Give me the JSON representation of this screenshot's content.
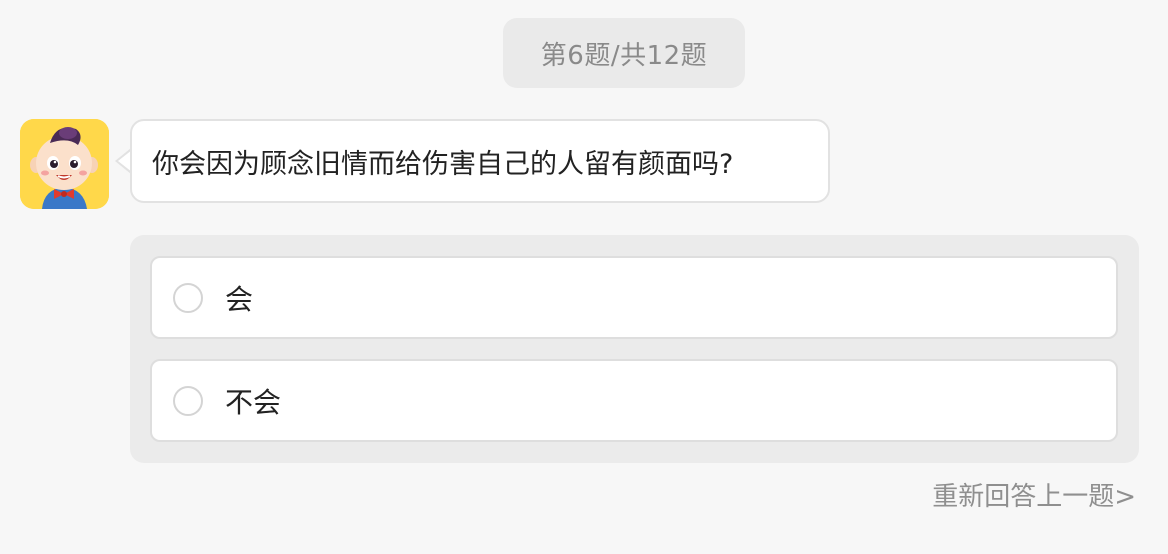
{
  "progress": {
    "text": "第6题/共12题",
    "current": 6,
    "total": 12
  },
  "avatar": {
    "icon": "cartoon-boy-avatar",
    "background": "#ffd84a"
  },
  "question": {
    "text": "你会因为顾念旧情而给伤害自己的人留有颜面吗?"
  },
  "options": [
    {
      "label": "会",
      "selected": false
    },
    {
      "label": "不会",
      "selected": false
    }
  ],
  "navigation": {
    "back_label": "重新回答上一题>"
  },
  "colors": {
    "page_background": "#f7f7f7",
    "panel_background": "#ebebeb",
    "muted_text": "#8a8a8a"
  }
}
